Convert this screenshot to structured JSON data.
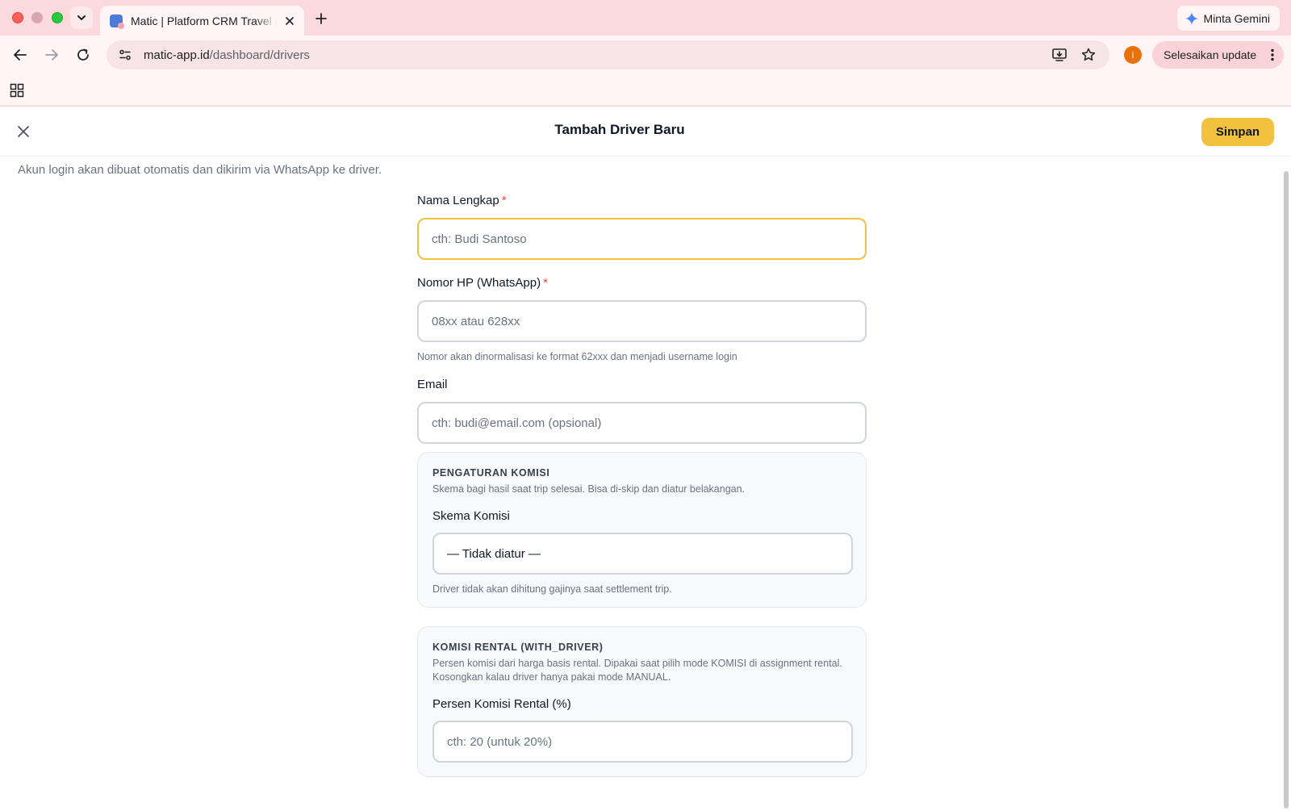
{
  "browser": {
    "tab_title": "Matic | Platform CRM Travel Dan Rental",
    "url_domain": "matic-app.id",
    "url_path": "/dashboard/drivers",
    "gemini_label": "Minta Gemini",
    "profile_initial": "i",
    "update_label": "Selesaikan update"
  },
  "page": {
    "title": "Tambah Driver Baru",
    "save_label": "Simpan",
    "subtitle": "Akun login akan dibuat otomatis dan dikirim via WhatsApp ke driver."
  },
  "form": {
    "name": {
      "label": "Nama Lengkap",
      "required_mark": "*",
      "placeholder": "cth: Budi Santoso"
    },
    "phone": {
      "label": "Nomor HP (WhatsApp)",
      "required_mark": "*",
      "placeholder": "08xx atau 628xx",
      "hint": "Nomor akan dinormalisasi ke format 62xxx dan menjadi username login"
    },
    "email": {
      "label": "Email",
      "placeholder": "cth: budi@email.com (opsional)"
    },
    "commission": {
      "title": "PENGATURAN KOMISI",
      "description": "Skema bagi hasil saat trip selesai. Bisa di-skip dan diatur belakangan.",
      "scheme_label": "Skema Komisi",
      "scheme_value": "— Tidak diatur —",
      "scheme_hint": "Driver tidak akan dihitung gajinya saat settlement trip."
    },
    "rental": {
      "title": "KOMISI RENTAL (WITH_DRIVER)",
      "description": "Persen komisi dari harga basis rental. Dipakai saat pilih mode KOMISI di assignment rental. Kosongkan kalau driver hanya pakai mode MANUAL.",
      "percent_label": "Persen Komisi Rental (%)",
      "percent_placeholder": "cth: 20 (untuk 20%)"
    }
  },
  "colors": {
    "accent": "#f2c13e",
    "required": "#ef4444",
    "chrome": "#fcd9dc"
  }
}
